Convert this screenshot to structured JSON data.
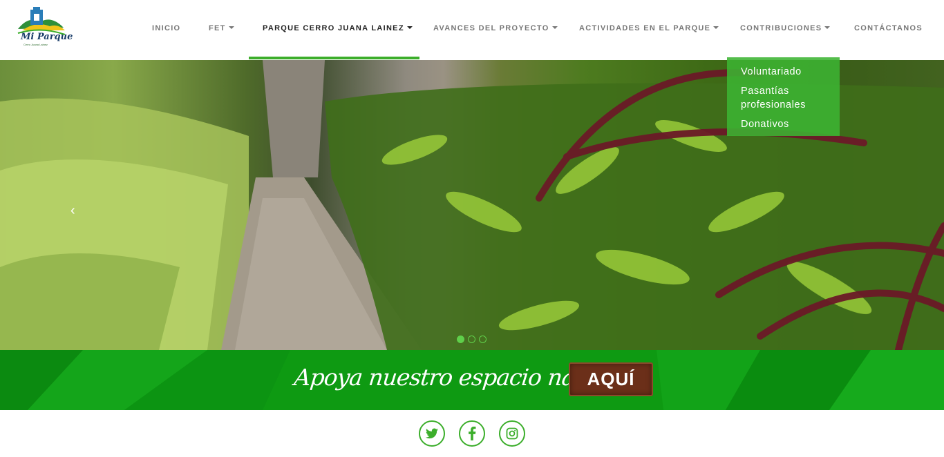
{
  "brand": {
    "name": "Mi Parque",
    "subtitle": "Cerro Juana Lainez"
  },
  "nav": {
    "items": [
      {
        "label": "INICIO",
        "dropdown": false
      },
      {
        "label": "FET",
        "dropdown": true
      },
      {
        "label": "PARQUE CERRO JUANA LAINEZ",
        "dropdown": true,
        "active": true
      },
      {
        "label": "AVANCES DEL PROYECTO",
        "dropdown": true
      },
      {
        "label": "ACTIVIDADES EN EL PARQUE",
        "dropdown": true
      },
      {
        "label": "CONTRIBUCIONES",
        "dropdown": true
      },
      {
        "label": "CONTÁCTANOS",
        "dropdown": false
      }
    ]
  },
  "dropdown": {
    "parent": "CONTRIBUCIONES",
    "items": [
      "Voluntariado",
      "Pasantías profesionales",
      "Donativos"
    ]
  },
  "carousel": {
    "prev_label": "‹",
    "slide_count": 3,
    "active_slide": 1
  },
  "banner": {
    "text": "Apoya nuestro espacio natural",
    "button_label": "AQUÍ"
  },
  "social": [
    {
      "icon": "twitter-icon"
    },
    {
      "icon": "facebook-icon"
    },
    {
      "icon": "instagram-icon"
    }
  ],
  "colors": {
    "accent": "#3cae2b",
    "banner": "#0e9a12",
    "button": "#6b2f19"
  }
}
